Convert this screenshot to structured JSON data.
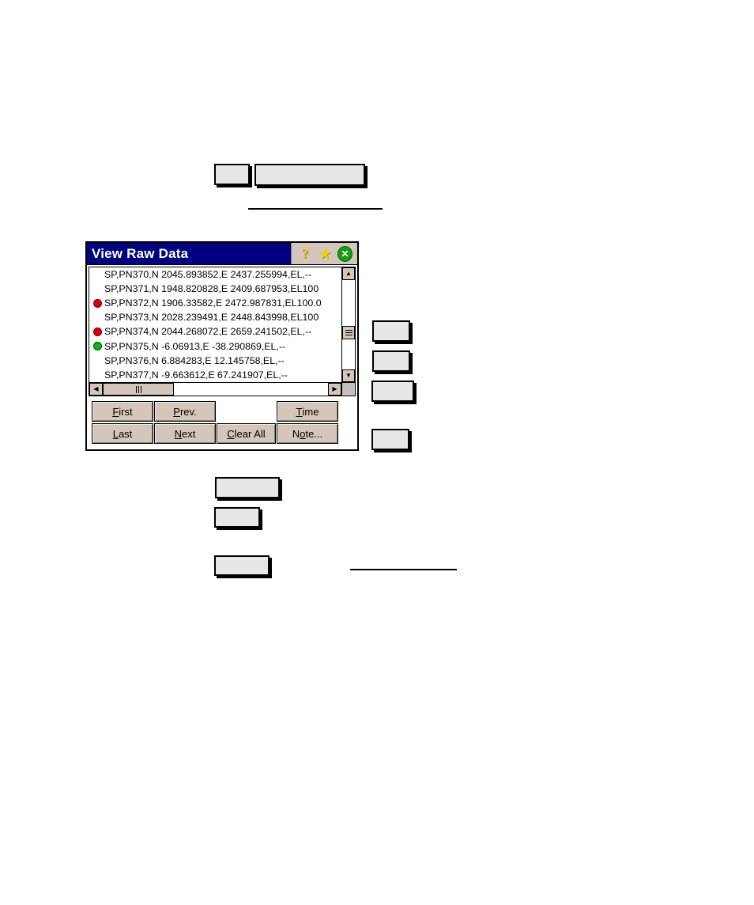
{
  "window": {
    "title": "View Raw Data",
    "icons": {
      "help": "?",
      "star": "★",
      "close": "✕"
    }
  },
  "raw_data_lines": [
    {
      "marker": "none",
      "text": "SP,PN370,N 2045.893852,E 2437.255994,EL,--"
    },
    {
      "marker": "none",
      "text": "SP,PN371,N 1948.820828,E 2409.687953,EL100"
    },
    {
      "marker": "red",
      "text": "SP,PN372,N 1906.33582,E 2472.987831,EL100.0"
    },
    {
      "marker": "none",
      "text": "SP,PN373,N 2028.239491,E 2448.843998,EL100"
    },
    {
      "marker": "red",
      "text": "SP,PN374,N 2044.268072,E 2659.241502,EL,--"
    },
    {
      "marker": "green",
      "text": "SP,PN375,N -6.06913,E -38.290869,EL,--"
    },
    {
      "marker": "none",
      "text": "SP,PN376,N 6.884283,E 12.145758,EL,--"
    },
    {
      "marker": "none",
      "text": "SP,PN377,N -9.663612,E 67.241907,EL,--"
    }
  ],
  "scrollbars": {
    "up_arrow": "▲",
    "down_arrow": "▼",
    "left_arrow": "◀",
    "right_arrow": "▶"
  },
  "buttons": {
    "first": {
      "prefix": "",
      "accel": "F",
      "suffix": "irst"
    },
    "prev": {
      "prefix": "",
      "accel": "P",
      "suffix": "rev."
    },
    "time": {
      "prefix": "",
      "accel": "T",
      "suffix": "ime"
    },
    "last": {
      "prefix": "",
      "accel": "L",
      "suffix": "ast"
    },
    "next": {
      "prefix": "",
      "accel": "N",
      "suffix": "ext"
    },
    "clear_all": {
      "prefix": "",
      "accel": "C",
      "suffix": "lear All"
    },
    "note": {
      "prefix": "N",
      "accel": "o",
      "suffix": "te..."
    }
  },
  "colors": {
    "titlebar": "#000080",
    "button_face": "#d4c6ba",
    "marker_red": "#e00000",
    "marker_green": "#00c000",
    "close_green": "#12a012",
    "placeholder_fill": "#e7e7e7"
  }
}
